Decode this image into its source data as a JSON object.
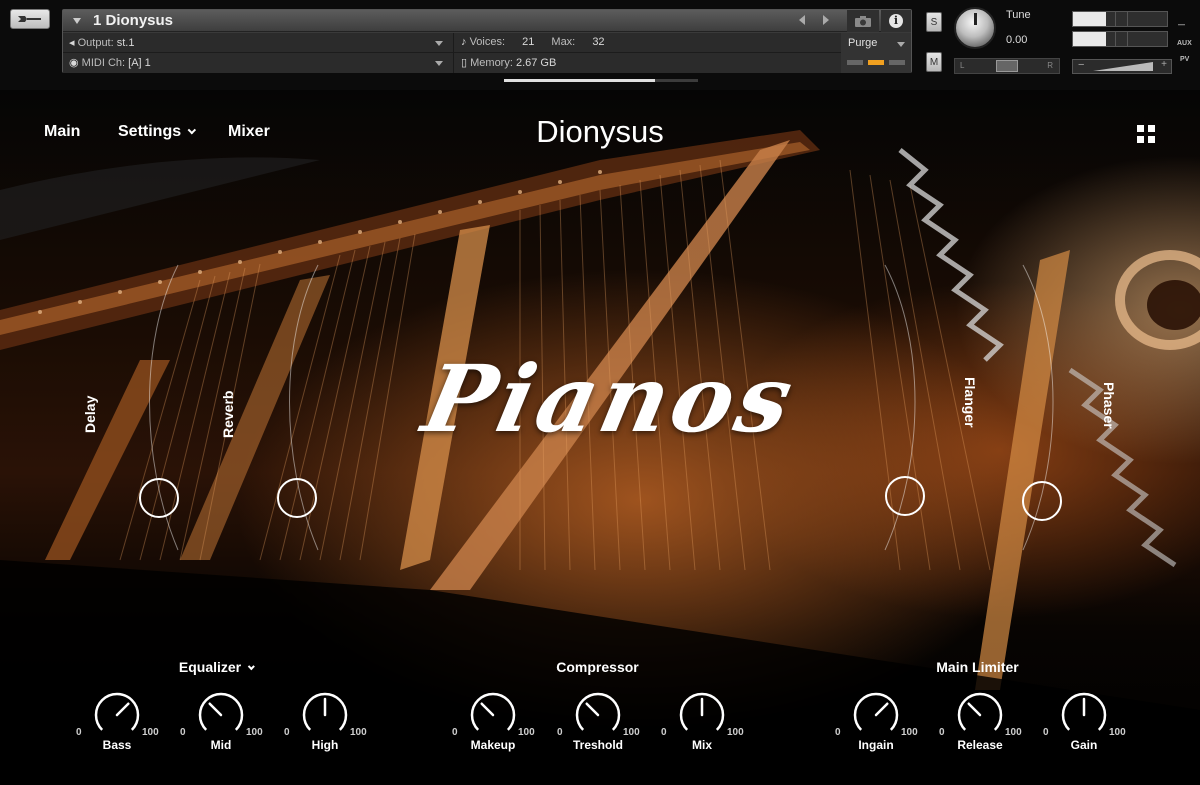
{
  "header": {
    "instrument_title": "1 Dionysus",
    "output_label": "Output:",
    "output_value": "st.1",
    "voices_label": "Voices:",
    "voices_value": "21",
    "max_label": "Max:",
    "max_value": "32",
    "purge_label": "Purge",
    "midi_label": "MIDI Ch:",
    "midi_value": "[A]  1",
    "memory_label": "Memory:",
    "memory_value": "2.67 GB",
    "solo_label": "S",
    "mute_label": "M",
    "tune_label": "Tune",
    "tune_value": "0.00",
    "pan_left": "L",
    "pan_right": "R",
    "aux_label": "AUX",
    "pv_label": "PV",
    "loading_progress": 0.78
  },
  "nav": {
    "main": "Main",
    "settings": "Settings",
    "mixer": "Mixer"
  },
  "instrument_name": "Dionysus",
  "logo_text": "Pianos",
  "effects": {
    "delay": "Delay",
    "reverb": "Reverb",
    "flanger": "Flanger",
    "phaser": "Phaser"
  },
  "sections": {
    "equalizer": {
      "title": "Equalizer",
      "knobs": [
        {
          "name": "Bass",
          "min": "0",
          "max": "100"
        },
        {
          "name": "Mid",
          "min": "0",
          "max": "100"
        },
        {
          "name": "High",
          "min": "0",
          "max": "100"
        }
      ]
    },
    "compressor": {
      "title": "Compressor",
      "knobs": [
        {
          "name": "Makeup",
          "min": "0",
          "max": "100"
        },
        {
          "name": "Treshold",
          "min": "0",
          "max": "100"
        },
        {
          "name": "Mix",
          "min": "0",
          "max": "100"
        }
      ]
    },
    "limiter": {
      "title": "Main Limiter",
      "knobs": [
        {
          "name": "Ingain",
          "min": "0",
          "max": "100"
        },
        {
          "name": "Release",
          "min": "0",
          "max": "100"
        },
        {
          "name": "Gain",
          "min": "0",
          "max": "100"
        }
      ]
    }
  },
  "colors": {
    "accent_led": "#f0a020",
    "text": "#ffffff",
    "panel": "#3a3a3a"
  }
}
